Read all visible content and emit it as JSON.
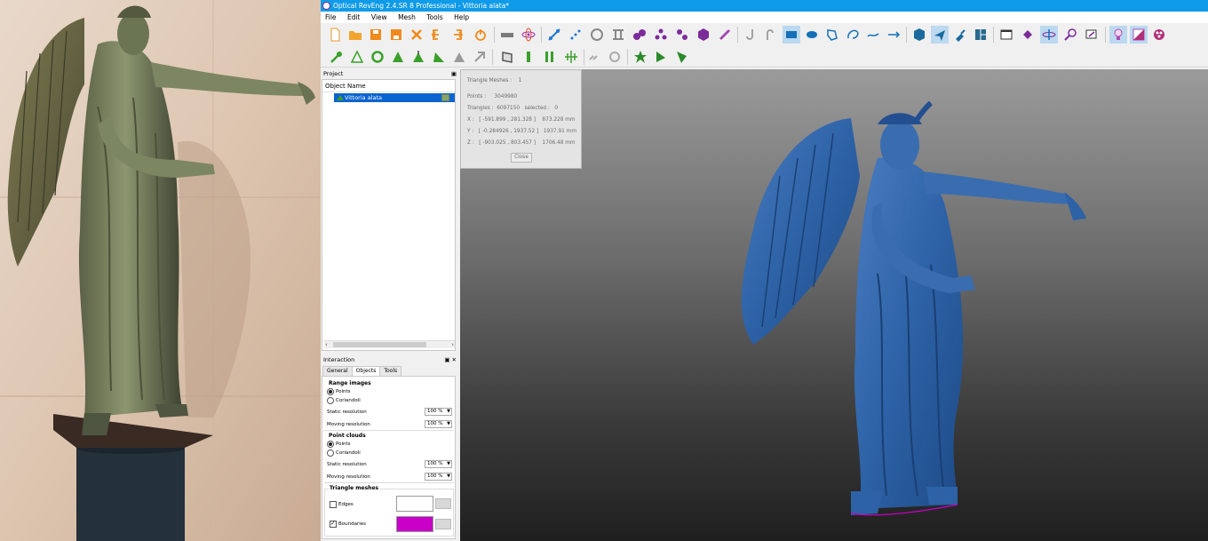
{
  "titlebar": {
    "title": "Optical RevEng 2.4.SR 8 Professional - Vittoria alata*"
  },
  "menubar": {
    "items": [
      "File",
      "Edit",
      "View",
      "Mesh",
      "Tools",
      "Help"
    ]
  },
  "project": {
    "title": "Project",
    "column_header": "Object Name",
    "items": [
      {
        "label": "Vittoria alata"
      }
    ]
  },
  "interaction": {
    "title": "Interaction",
    "tabs": [
      "General",
      "Objects",
      "Tools"
    ],
    "active_tab": "Objects",
    "range_images": {
      "title": "Range images",
      "options": [
        "Points",
        "Coriandoli"
      ],
      "selected": "Points",
      "static_label": "Static resolution",
      "static_value": "100 %",
      "moving_label": "Moving resolution",
      "moving_value": "100 %"
    },
    "point_clouds": {
      "title": "Point clouds",
      "options": [
        "Points",
        "Coriandoli"
      ],
      "selected": "Points",
      "static_label": "Static resolution",
      "static_value": "100 %",
      "moving_label": "Moving resolution",
      "moving_value": "100 %"
    },
    "triangle_meshes": {
      "title": "Triangle meshes",
      "edges_label": "Edges",
      "edges_checked": false,
      "edges_color": "#ffffff",
      "boundaries_label": "Boundaries",
      "boundaries_checked": true,
      "boundaries_color": "#c800c8"
    }
  },
  "info_popup": {
    "triangle_meshes": "Triangle Meshes :    1",
    "points": "Points :     3049980",
    "triangles": "Triangles :  6097150   selected :   0",
    "x": "X :   [ -591.899 , 281.328 ]    873.228 mm",
    "y": "Y :   [ -0.284926 , 1937.52 ]   1937.91 mm",
    "z": "Z :   [ -903.025 , 803.457 ]    1706.48 mm",
    "close_label": "Close"
  },
  "toolbar1": {
    "icons": [
      "new-file-icon",
      "open-folder-icon",
      "save-icon",
      "save-as-icon",
      "delete-x-icon",
      "import-icon",
      "export-icon",
      "power-icon",
      "scanner-icon",
      "atom-icon",
      "align-icon",
      "points-align-icon",
      "rotate-icon",
      "tool-icon",
      "merge-icon",
      "cluster-icon",
      "spheres-icon",
      "hexagon-icon",
      "ruler-icon",
      "hook-icon",
      "curve-icon",
      "rectangle-select-icon",
      "ellipse-select-icon",
      "polygon-select-icon",
      "lasso-icon",
      "line-icon",
      "arrow-line-icon",
      "cube-view-icon",
      "plane-icon",
      "clean-icon",
      "layout-icon",
      "window-icon",
      "diamond-icon",
      "axis-icon",
      "zoom-icon",
      "screen-icon",
      "light-icon",
      "shade-icon",
      "palette-icon"
    ],
    "active": [
      "rectangle-select-icon",
      "plane-icon",
      "axis-icon",
      "light-icon",
      "shade-icon"
    ]
  },
  "toolbar2": {
    "icons": [
      "wrench-icon",
      "triangle-outline-icon",
      "recycle-icon",
      "triangle-fill-icon",
      "triangle-edit-icon",
      "triangle-smooth-icon",
      "triangle-grey-icon",
      "fix-grey-icon",
      "surface-icon",
      "bar-icon",
      "double-bar-icon",
      "mesh-grid-icon",
      "link-icon",
      "unlink-icon",
      "green-star-icon",
      "green-arrow-icon",
      "green-cone-icon"
    ]
  },
  "colors": {
    "accent": "#0f9be8",
    "selection": "#0b63d1",
    "mesh_blue": "#2d62a6"
  }
}
